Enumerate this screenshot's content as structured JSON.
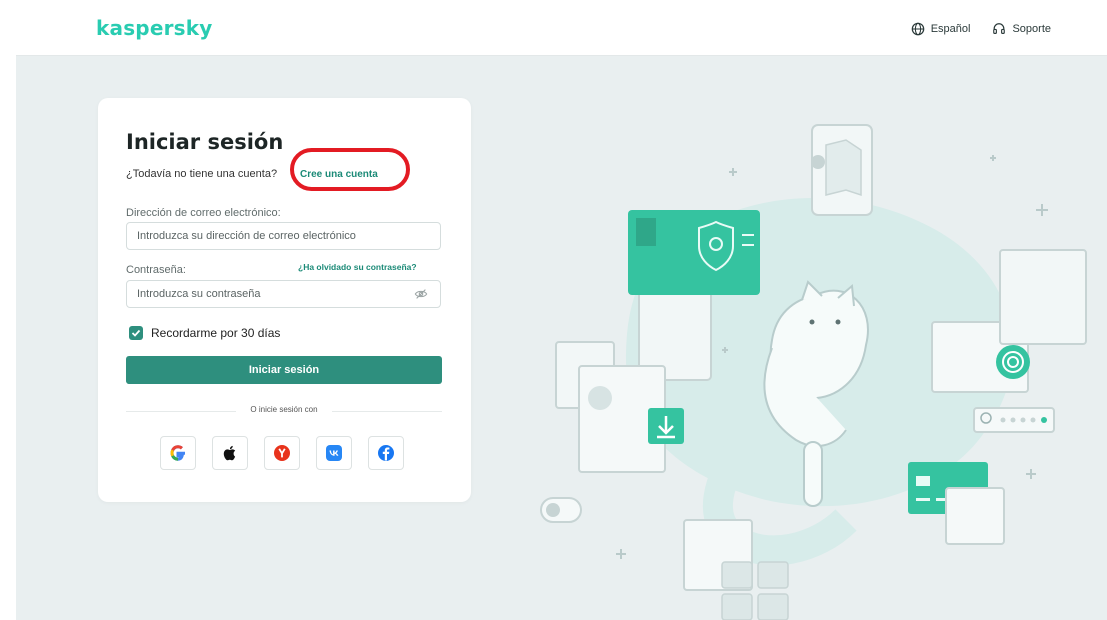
{
  "header": {
    "logo": "kaspersky",
    "language": "Español",
    "support": "Soporte"
  },
  "login": {
    "title": "Iniciar sesión",
    "no_account": "¿Todavía no tiene una cuenta?",
    "create_account": "Cree una cuenta",
    "email_label": "Dirección de correo electrónico:",
    "email_placeholder": "Introduzca su dirección de correo electrónico",
    "password_label": "Contraseña:",
    "forgot_password": "¿Ha olvidado su contraseña?",
    "password_placeholder": "Introduzca su contraseña",
    "remember_label": "Recordarme por 30 días",
    "remember_checked": true,
    "submit_label": "Iniciar sesión",
    "alt_login": "O inicie sesión con",
    "social_providers": [
      "google-icon",
      "apple-icon",
      "yandex-icon",
      "vk-icon",
      "facebook-icon"
    ]
  },
  "colors": {
    "brand": "#29ccb1",
    "primary": "#2e8f7e",
    "annotation": "#e31b23",
    "background": "#e9eff0"
  }
}
